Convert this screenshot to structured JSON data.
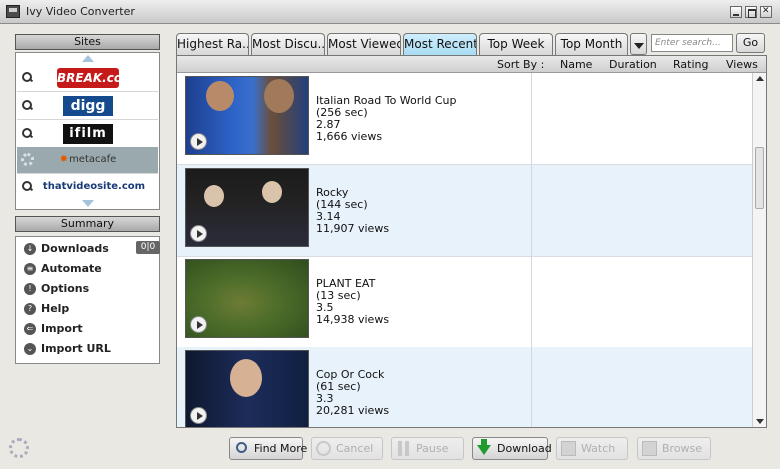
{
  "window": {
    "title": "Ivy Video Converter",
    "minimize_icon": "minimize-icon",
    "maximize_icon": "maximize-icon",
    "close_icon": "close-icon"
  },
  "sites": {
    "header": "Sites",
    "items": [
      {
        "name": "BREAK.com",
        "icon": "search-icon"
      },
      {
        "name": "digg",
        "icon": "search-icon"
      },
      {
        "name": "ifilm",
        "icon": "search-icon"
      },
      {
        "name": "metacafe",
        "icon": "loading-spinner-icon",
        "selected": true
      },
      {
        "name": "thatvideosite.com",
        "icon": "search-icon"
      }
    ]
  },
  "summary": {
    "header": "Summary",
    "downloads_badge": "0|0",
    "items": [
      {
        "label": "Downloads",
        "icon": "download-icon"
      },
      {
        "label": "Automate",
        "icon": "automate-icon"
      },
      {
        "label": "Options",
        "icon": "options-icon"
      },
      {
        "label": "Help",
        "icon": "help-icon"
      },
      {
        "label": "Import",
        "icon": "import-icon"
      },
      {
        "label": "Import URL",
        "icon": "import-url-icon"
      }
    ]
  },
  "tabs": [
    {
      "label": "Highest Ra..."
    },
    {
      "label": "Most Discu..."
    },
    {
      "label": "Most Viewed"
    },
    {
      "label": "Most Recent",
      "active": true
    },
    {
      "label": "Top Week"
    },
    {
      "label": "Top Month"
    }
  ],
  "search": {
    "placeholder": "Enter search...",
    "go_label": "Go"
  },
  "sort_bar": {
    "sort_by": "Sort By :",
    "name": "Name",
    "duration": "Duration",
    "rating": "Rating",
    "views": "Views"
  },
  "videos": [
    {
      "title": "Italian Road To World Cup",
      "duration": "(256 sec)",
      "rating": "2.87",
      "views": "1,666 views"
    },
    {
      "title": "Rocky",
      "duration": "(144 sec)",
      "rating": "3.14",
      "views": "11,907 views"
    },
    {
      "title": "PLANT EAT",
      "duration": "(13 sec)",
      "rating": "3.5",
      "views": "14,938 views"
    },
    {
      "title": "Cop Or Cock",
      "duration": "(61 sec)",
      "rating": "3.3",
      "views": "20,281 views"
    }
  ],
  "bottom_buttons": {
    "find_more": "Find More",
    "cancel": "Cancel",
    "pause": "Pause",
    "download": "Download",
    "watch": "Watch",
    "browse": "Browse"
  }
}
